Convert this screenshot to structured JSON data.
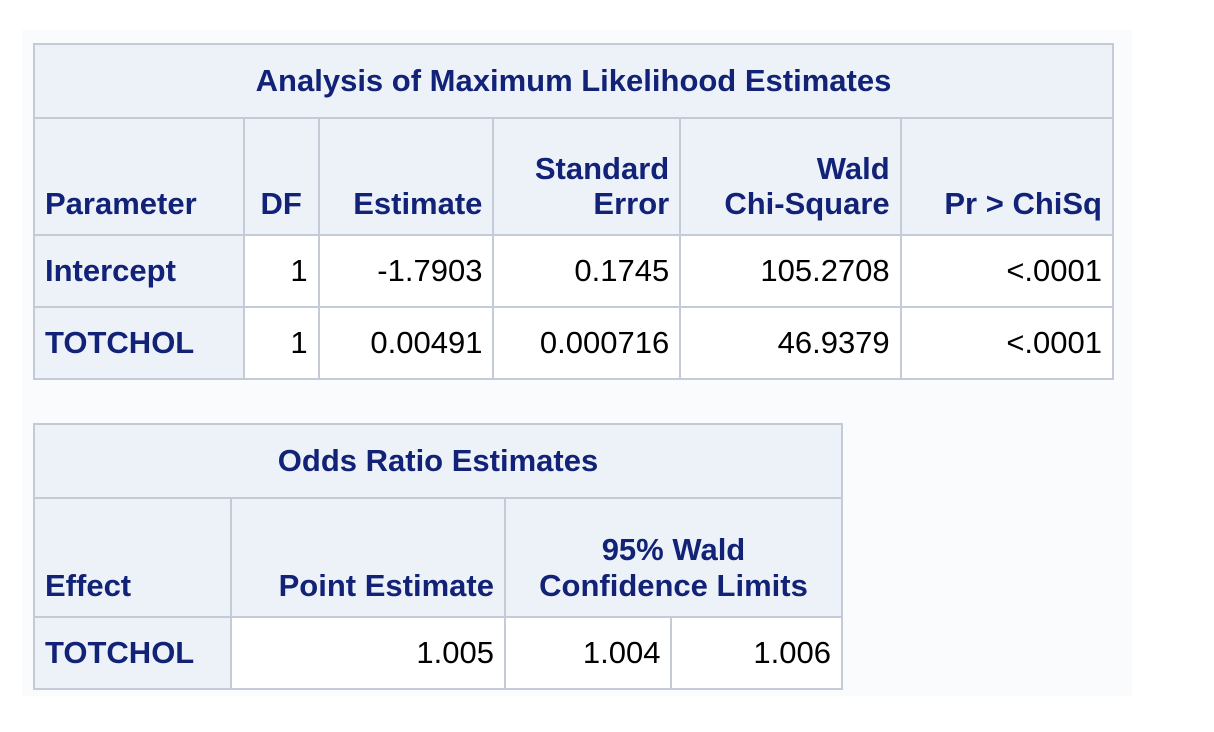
{
  "mle_table": {
    "title": "Analysis of Maximum Likelihood Estimates",
    "headers": {
      "parameter": "Parameter",
      "df": "DF",
      "estimate": "Estimate",
      "std_error_line1": "Standard",
      "std_error_line2": "Error",
      "wald_line1": "Wald",
      "wald_line2": "Chi-Square",
      "p_value": "Pr > ChiSq"
    },
    "rows": [
      {
        "parameter": "Intercept",
        "df": "1",
        "estimate": "-1.7903",
        "std_error": "0.1745",
        "wald_chisq": "105.2708",
        "p_value": "<.0001"
      },
      {
        "parameter": "TOTCHOL",
        "df": "1",
        "estimate": "0.00491",
        "std_error": "0.000716",
        "wald_chisq": "46.9379",
        "p_value": "<.0001"
      }
    ]
  },
  "odds_ratio_table": {
    "title": "Odds Ratio Estimates",
    "headers": {
      "effect": "Effect",
      "point_estimate": "Point Estimate",
      "ci_line1": "95% Wald",
      "ci_line2": "Confidence Limits"
    },
    "rows": [
      {
        "effect": "TOTCHOL",
        "point_estimate": "1.005",
        "lower": "1.004",
        "upper": "1.006"
      }
    ]
  },
  "colors": {
    "header_bg": "#edf2f9",
    "header_text": "#112277",
    "border": "#c5cbd6"
  }
}
